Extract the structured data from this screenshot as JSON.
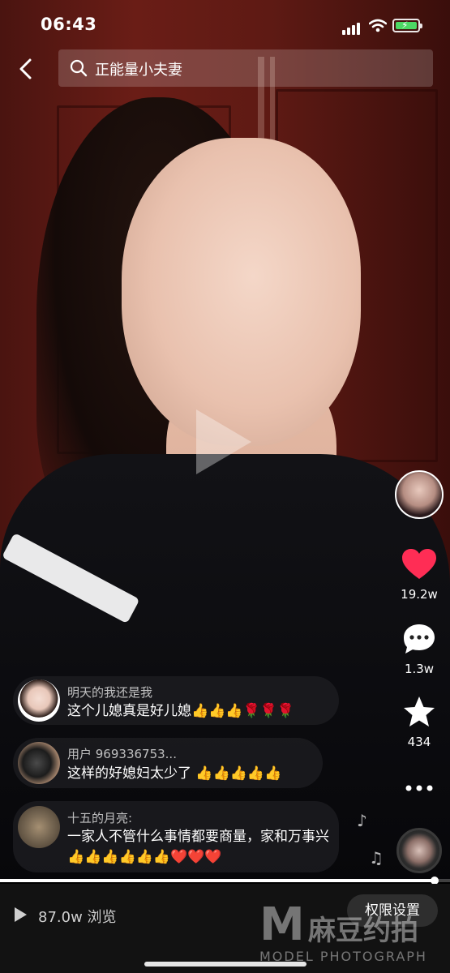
{
  "status_bar": {
    "time": "06:43"
  },
  "search": {
    "query": "正能量小夫妻"
  },
  "rail": {
    "likes": "19.2w",
    "comments": "1.3w",
    "favorites": "434"
  },
  "comments": [
    {
      "name": "明天的我还是我",
      "text": "这个儿媳真是好儿媳👍👍👍🌹🌹🌹"
    },
    {
      "name": "用户 969336753...",
      "text": "这样的好媳妇太少了 👍👍👍👍👍"
    },
    {
      "name": "十五的月亮:",
      "text": "一家人不管什么事情都要商量，家和万事兴👍👍👍👍👍👍❤️❤️❤️"
    }
  ],
  "progress": {
    "fraction": 0.965
  },
  "bottom": {
    "views": "87.0w 浏览",
    "permission_button": "权限设置"
  },
  "watermark": {
    "mark": "M",
    "cn": "麻豆约拍",
    "en": "MODEL PHOTOGRAPH"
  },
  "colors": {
    "like_heart": "#ff2d55",
    "battery": "#4cd964",
    "bottom_bar": "#121212"
  }
}
